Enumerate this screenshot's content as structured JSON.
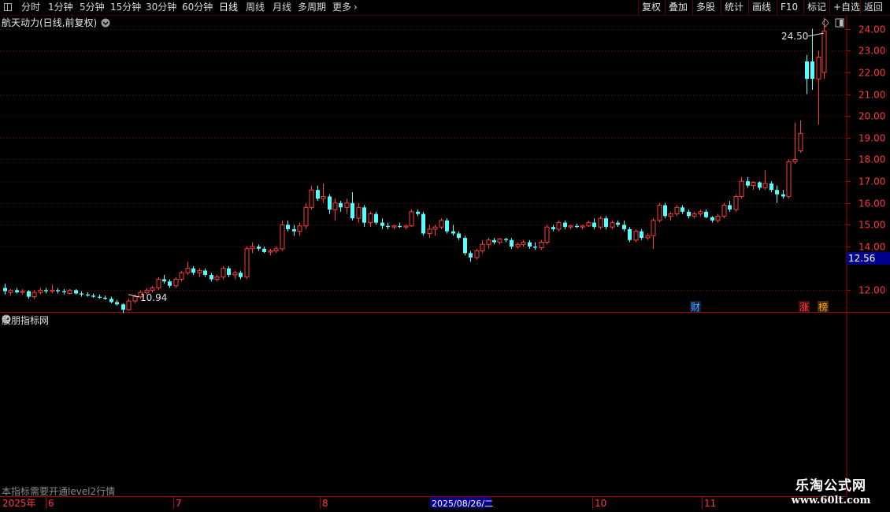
{
  "toolbar": {
    "periods": [
      "分时",
      "1分钟",
      "5分钟",
      "15分钟",
      "30分钟",
      "60分钟",
      "日线",
      "周线",
      "月线",
      "多周期",
      "更多"
    ],
    "active_period": "日线",
    "more_arrow": "›",
    "right_buttons": [
      "复权",
      "叠加",
      "多股",
      "统计",
      "画线",
      "F10",
      "+自选",
      "返回"
    ],
    "right_buttons_2": [
      "标记"
    ]
  },
  "main_panel": {
    "title": "航天动力(日线,前复权)",
    "title_dropdown_icon": "chevron-down-icon",
    "price_axis_labels": [
      "24.00",
      "23.00",
      "22.00",
      "21.00",
      "20.00",
      "19.00",
      "18.00",
      "17.00",
      "16.00",
      "15.00",
      "14.00",
      "12.00"
    ],
    "current_price": "12.56",
    "high_label": "24.50",
    "low_label": "10.94",
    "event_badges": [
      {
        "text": "财",
        "color": "#4fa8ff"
      },
      {
        "text": "涨",
        "color": "#ff4040"
      },
      {
        "text": "榜",
        "color": "#ffa020"
      }
    ]
  },
  "indicator_panel": {
    "title": "股朋指标网",
    "notice": "本指标需要开通level2行情"
  },
  "time_axis": {
    "labels": [
      "2025年",
      "6",
      "7",
      "8",
      "2025/08/26/二",
      "10",
      "11"
    ],
    "highlight": "2025/08/26/二"
  },
  "watermark": {
    "line1": "乐淘公式网",
    "line2": "www.60lt.com"
  },
  "chart_data": {
    "type": "candlestick",
    "title": "航天动力(日线,前复权)",
    "y_axis_ticks": [
      12,
      14,
      15,
      16,
      17,
      18,
      19,
      20,
      21,
      22,
      23,
      24
    ],
    "ylim": [
      11.0,
      24.6
    ],
    "marked_high": 24.5,
    "marked_low": 10.94,
    "current_price": 12.56,
    "colors": {
      "up": "#ff3c3c",
      "down": "#54ffff",
      "grid": "#7a0000",
      "frame": "#b00000"
    },
    "ohlc": [
      [
        12.1,
        12.3,
        11.8,
        11.95
      ],
      [
        11.9,
        12.05,
        11.75,
        12.0
      ],
      [
        12.0,
        12.1,
        11.85,
        11.9
      ],
      [
        11.9,
        12.05,
        11.8,
        11.95
      ],
      [
        11.95,
        12.0,
        11.6,
        11.7
      ],
      [
        11.7,
        12.0,
        11.6,
        11.9
      ],
      [
        11.9,
        12.1,
        11.8,
        12.0
      ],
      [
        12.0,
        12.1,
        11.85,
        11.95
      ],
      [
        11.95,
        12.25,
        11.85,
        12.0
      ],
      [
        12.0,
        12.1,
        11.85,
        11.95
      ],
      [
        11.95,
        12.05,
        11.8,
        11.9
      ],
      [
        11.85,
        12.05,
        11.8,
        12.0
      ],
      [
        12.0,
        12.05,
        11.8,
        11.85
      ],
      [
        11.85,
        11.95,
        11.7,
        11.8
      ],
      [
        11.8,
        11.9,
        11.7,
        11.75
      ],
      [
        11.75,
        11.85,
        11.65,
        11.7
      ],
      [
        11.7,
        11.8,
        11.6,
        11.65
      ],
      [
        11.65,
        11.75,
        11.55,
        11.6
      ],
      [
        11.6,
        11.7,
        11.4,
        11.45
      ],
      [
        11.45,
        11.55,
        11.3,
        11.35
      ],
      [
        11.35,
        11.4,
        10.94,
        11.1
      ],
      [
        11.1,
        11.6,
        11.05,
        11.5
      ],
      [
        11.5,
        11.8,
        11.4,
        11.7
      ],
      [
        11.7,
        12.0,
        11.6,
        11.9
      ],
      [
        11.9,
        12.1,
        11.8,
        12.0
      ],
      [
        12.0,
        12.2,
        11.9,
        12.1
      ],
      [
        12.1,
        12.6,
        12.0,
        12.5
      ],
      [
        12.5,
        12.7,
        12.3,
        12.4
      ],
      [
        12.4,
        12.5,
        12.1,
        12.2
      ],
      [
        12.2,
        12.6,
        12.1,
        12.5
      ],
      [
        12.5,
        12.9,
        12.4,
        12.8
      ],
      [
        12.8,
        13.3,
        12.7,
        13.0
      ],
      [
        13.0,
        13.1,
        12.7,
        12.8
      ],
      [
        12.8,
        13.0,
        12.6,
        12.9
      ],
      [
        12.9,
        13.0,
        12.6,
        12.7
      ],
      [
        12.7,
        12.8,
        12.4,
        12.5
      ],
      [
        12.5,
        12.7,
        12.4,
        12.6
      ],
      [
        12.6,
        13.1,
        12.5,
        13.0
      ],
      [
        13.0,
        13.1,
        12.6,
        12.7
      ],
      [
        12.7,
        12.9,
        12.5,
        12.8
      ],
      [
        12.8,
        12.9,
        12.5,
        12.6
      ],
      [
        12.6,
        14.0,
        12.5,
        13.9
      ],
      [
        13.9,
        14.2,
        13.7,
        14.0
      ],
      [
        14.0,
        14.1,
        13.8,
        13.9
      ],
      [
        13.9,
        14.0,
        13.7,
        13.75
      ],
      [
        13.75,
        13.9,
        13.6,
        13.8
      ],
      [
        13.8,
        14.0,
        13.7,
        13.9
      ],
      [
        13.9,
        15.2,
        13.8,
        15.0
      ],
      [
        15.0,
        15.2,
        14.7,
        14.8
      ],
      [
        14.8,
        15.0,
        14.5,
        14.7
      ],
      [
        14.7,
        15.1,
        14.5,
        14.95
      ],
      [
        14.95,
        16.0,
        14.8,
        15.8
      ],
      [
        15.8,
        16.8,
        15.7,
        16.6
      ],
      [
        16.6,
        16.8,
        16.1,
        16.2
      ],
      [
        16.2,
        16.9,
        16.0,
        16.3
      ],
      [
        16.3,
        16.4,
        15.5,
        15.7
      ],
      [
        15.7,
        16.2,
        15.2,
        16.0
      ],
      [
        16.0,
        16.1,
        15.6,
        15.8
      ],
      [
        15.8,
        16.2,
        15.5,
        16.0
      ],
      [
        16.0,
        16.5,
        15.2,
        15.3
      ],
      [
        15.3,
        16.0,
        15.1,
        15.8
      ],
      [
        15.8,
        15.9,
        14.9,
        15.1
      ],
      [
        15.1,
        15.6,
        14.9,
        15.5
      ],
      [
        15.5,
        15.6,
        15.0,
        15.1
      ],
      [
        15.1,
        15.3,
        14.8,
        14.95
      ],
      [
        14.95,
        15.1,
        14.8,
        14.9
      ],
      [
        14.9,
        15.0,
        14.8,
        14.95
      ],
      [
        14.95,
        15.1,
        14.85,
        14.9
      ],
      [
        14.9,
        15.0,
        14.8,
        14.95
      ],
      [
        14.95,
        15.7,
        14.9,
        15.6
      ],
      [
        15.6,
        15.7,
        15.4,
        15.5
      ],
      [
        15.5,
        15.6,
        14.5,
        14.6
      ],
      [
        14.6,
        15.0,
        14.4,
        14.8
      ],
      [
        14.8,
        15.0,
        14.5,
        14.9
      ],
      [
        14.9,
        15.3,
        14.8,
        15.2
      ],
      [
        15.2,
        15.3,
        14.6,
        14.7
      ],
      [
        14.7,
        15.0,
        14.5,
        14.6
      ],
      [
        14.6,
        14.7,
        14.3,
        14.4
      ],
      [
        14.4,
        14.5,
        13.6,
        13.7
      ],
      [
        13.7,
        13.8,
        13.3,
        13.5
      ],
      [
        13.5,
        13.9,
        13.4,
        13.8
      ],
      [
        13.8,
        14.3,
        13.7,
        14.1
      ],
      [
        14.1,
        14.4,
        13.9,
        14.3
      ],
      [
        14.3,
        14.4,
        14.1,
        14.2
      ],
      [
        14.2,
        14.4,
        14.1,
        14.35
      ],
      [
        14.35,
        14.4,
        14.2,
        14.3
      ],
      [
        14.3,
        14.4,
        13.9,
        14.0
      ],
      [
        14.0,
        14.2,
        13.9,
        14.1
      ],
      [
        14.1,
        14.3,
        14.0,
        14.2
      ],
      [
        14.2,
        14.3,
        13.9,
        14.0
      ],
      [
        14.0,
        14.2,
        13.85,
        13.95
      ],
      [
        13.95,
        14.3,
        13.85,
        14.2
      ],
      [
        14.2,
        15.0,
        14.1,
        14.9
      ],
      [
        14.9,
        15.0,
        14.7,
        14.8
      ],
      [
        14.8,
        15.2,
        14.7,
        15.1
      ],
      [
        15.1,
        15.2,
        14.8,
        14.9
      ],
      [
        14.9,
        15.0,
        14.8,
        14.95
      ],
      [
        14.95,
        15.05,
        14.85,
        14.9
      ],
      [
        14.9,
        15.0,
        14.8,
        14.95
      ],
      [
        14.95,
        15.2,
        14.9,
        15.1
      ],
      [
        15.1,
        15.3,
        14.8,
        14.9
      ],
      [
        14.9,
        15.4,
        14.8,
        15.3
      ],
      [
        15.3,
        15.4,
        14.8,
        14.9
      ],
      [
        14.9,
        15.2,
        14.8,
        15.1
      ],
      [
        15.1,
        15.2,
        14.9,
        15.0
      ],
      [
        15.0,
        15.2,
        14.7,
        14.8
      ],
      [
        14.8,
        14.9,
        14.2,
        14.3
      ],
      [
        14.3,
        14.8,
        14.2,
        14.7
      ],
      [
        14.7,
        14.8,
        14.3,
        14.4
      ],
      [
        14.4,
        14.6,
        14.3,
        14.5
      ],
      [
        14.5,
        15.3,
        13.9,
        15.2
      ],
      [
        15.2,
        16.0,
        15.1,
        15.9
      ],
      [
        15.9,
        16.0,
        15.3,
        15.4
      ],
      [
        15.4,
        15.6,
        15.2,
        15.5
      ],
      [
        15.5,
        15.9,
        15.4,
        15.8
      ],
      [
        15.8,
        15.9,
        15.5,
        15.6
      ],
      [
        15.6,
        15.7,
        15.3,
        15.4
      ],
      [
        15.4,
        15.6,
        15.3,
        15.5
      ],
      [
        15.5,
        15.7,
        15.4,
        15.6
      ],
      [
        15.6,
        15.7,
        15.3,
        15.35
      ],
      [
        15.35,
        15.4,
        15.1,
        15.2
      ],
      [
        15.2,
        15.5,
        15.1,
        15.4
      ],
      [
        15.4,
        16.0,
        15.3,
        15.9
      ],
      [
        15.9,
        16.1,
        15.6,
        15.7
      ],
      [
        15.7,
        16.4,
        15.6,
        16.3
      ],
      [
        16.3,
        17.2,
        16.2,
        17.0
      ],
      [
        17.0,
        17.2,
        16.7,
        16.8
      ],
      [
        16.8,
        17.0,
        16.6,
        16.95
      ],
      [
        16.95,
        17.0,
        16.6,
        16.7
      ],
      [
        16.7,
        17.5,
        16.6,
        16.9
      ],
      [
        16.9,
        17.0,
        16.5,
        16.6
      ],
      [
        16.6,
        16.8,
        16.0,
        16.4
      ],
      [
        16.4,
        16.6,
        16.2,
        16.3
      ],
      [
        16.3,
        18.0,
        16.2,
        17.9
      ],
      [
        17.9,
        19.7,
        17.8,
        18.0
      ],
      [
        18.4,
        19.8,
        18.3,
        19.2
      ],
      [
        22.5,
        22.8,
        21.0,
        21.7
      ],
      [
        22.5,
        24.0,
        21.2,
        21.7
      ],
      [
        21.7,
        23.0,
        19.6,
        22.7
      ],
      [
        22.0,
        24.5,
        21.7,
        23.9
      ]
    ]
  }
}
